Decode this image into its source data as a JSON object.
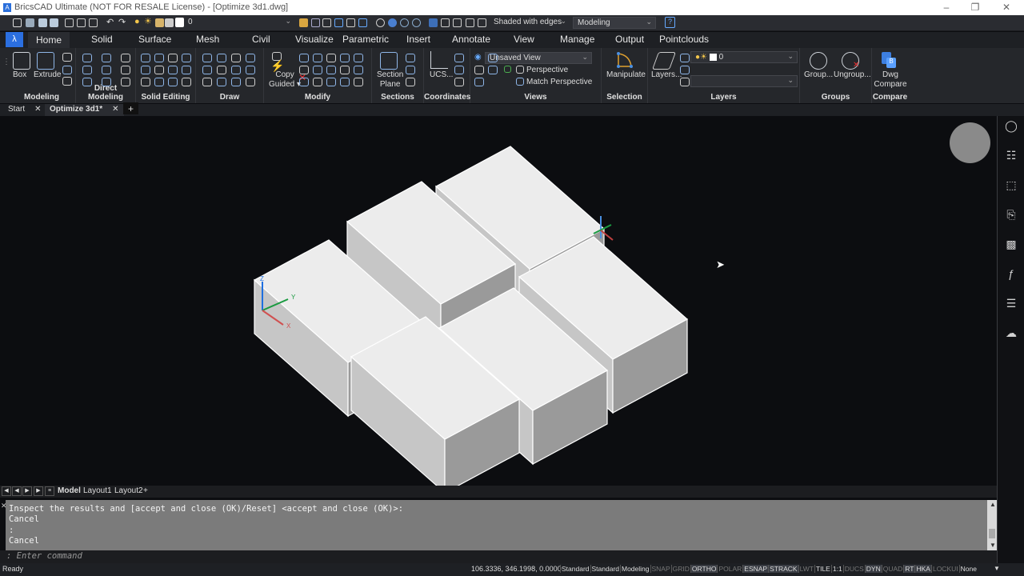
{
  "window": {
    "title": "BricsCAD Ultimate (NOT FOR RESALE License) - [Optimize 3d1.dwg]",
    "app_icon": "bricscad-logo-icon"
  },
  "qat": {
    "layer_value": "0",
    "visual_style": "Shaded with edges",
    "workspace": "Modeling"
  },
  "ribbon_tabs": [
    "Home",
    "Solid",
    "Surface",
    "Mesh",
    "Civil",
    "Visualize",
    "Parametric",
    "Insert",
    "Annotate",
    "View",
    "Manage",
    "Output",
    "Pointclouds"
  ],
  "active_tab": "Home",
  "ribbon": {
    "modeling": {
      "title": "Modeling",
      "box": "Box",
      "extrude": "Extrude"
    },
    "direct_modeling": {
      "title": "Direct Modeling"
    },
    "solid_editing": {
      "title": "Solid Editing"
    },
    "draw": {
      "title": "Draw"
    },
    "modify": {
      "title": "Modify",
      "copy_guided_1": "Copy",
      "copy_guided_2": "Guided"
    },
    "sections": {
      "title": "Sections",
      "section_plane_1": "Section",
      "section_plane_2": "Plane"
    },
    "coordinates": {
      "title": "Coordinates",
      "ucs": "UCS..."
    },
    "views": {
      "title": "Views",
      "view_combo": "Unsaved View",
      "perspective": "Perspective",
      "match_perspective": "Match Perspective"
    },
    "selection": {
      "title": "Selection",
      "manipulate": "Manipulate"
    },
    "layers": {
      "title": "Layers",
      "layers_btn": "Layers...",
      "layer_value": "0"
    },
    "groups": {
      "title": "Groups",
      "group": "Group...",
      "ungroup": "Ungroup..."
    },
    "compare": {
      "title": "Compare",
      "dwg_compare_1": "Dwg",
      "dwg_compare_2": "Compare"
    }
  },
  "doc_tabs": [
    {
      "label": "Start"
    },
    {
      "label": "Optimize 3d1*"
    }
  ],
  "layout_tabs": [
    "Model",
    "Layout1",
    "Layout2"
  ],
  "command": {
    "history": [
      "Inspect the results and [accept and close (OK)/Reset] <accept and close (OK)>:",
      "Cancel",
      ":",
      "Cancel"
    ],
    "prompt": ": Enter command"
  },
  "ucs_labels": {
    "x": "X",
    "y": "Y",
    "z": "Z"
  },
  "status": {
    "ready": "Ready",
    "coords": "106.3336, 346.1998, 0.0000",
    "items": [
      {
        "label": "Standard",
        "state": "text"
      },
      {
        "label": "Standard",
        "state": "text"
      },
      {
        "label": "Modeling",
        "state": "text"
      },
      {
        "label": "SNAP",
        "state": "off"
      },
      {
        "label": "GRID",
        "state": "off"
      },
      {
        "label": "ORTHO",
        "state": "on"
      },
      {
        "label": "POLAR",
        "state": "off"
      },
      {
        "label": "ESNAP",
        "state": "on"
      },
      {
        "label": "STRACK",
        "state": "on"
      },
      {
        "label": "LWT",
        "state": "off"
      },
      {
        "label": "TILE",
        "state": "text"
      },
      {
        "label": "1:1",
        "state": "text"
      },
      {
        "label": "DUCS",
        "state": "off"
      },
      {
        "label": "DYN",
        "state": "on"
      },
      {
        "label": "QUAD",
        "state": "off"
      },
      {
        "label": "RT",
        "state": "on"
      },
      {
        "label": "HKA",
        "state": "on"
      },
      {
        "label": "LOCKUI",
        "state": "off"
      },
      {
        "label": "None",
        "state": "text"
      }
    ]
  },
  "side_panel_icons": [
    "lightbulb-icon",
    "properties-sliders-icon",
    "layers-icon",
    "attachments-icon",
    "drawing-explorer-icon",
    "parameters-fx-icon",
    "structure-tree-icon",
    "cloud-upload-icon"
  ],
  "colors": {
    "accent": "#2b6fe0",
    "viewport_bg": "#0c0d10",
    "solid_top": "#ececec",
    "solid_left": "#c6c6c6",
    "solid_right": "#9a9a9a"
  }
}
